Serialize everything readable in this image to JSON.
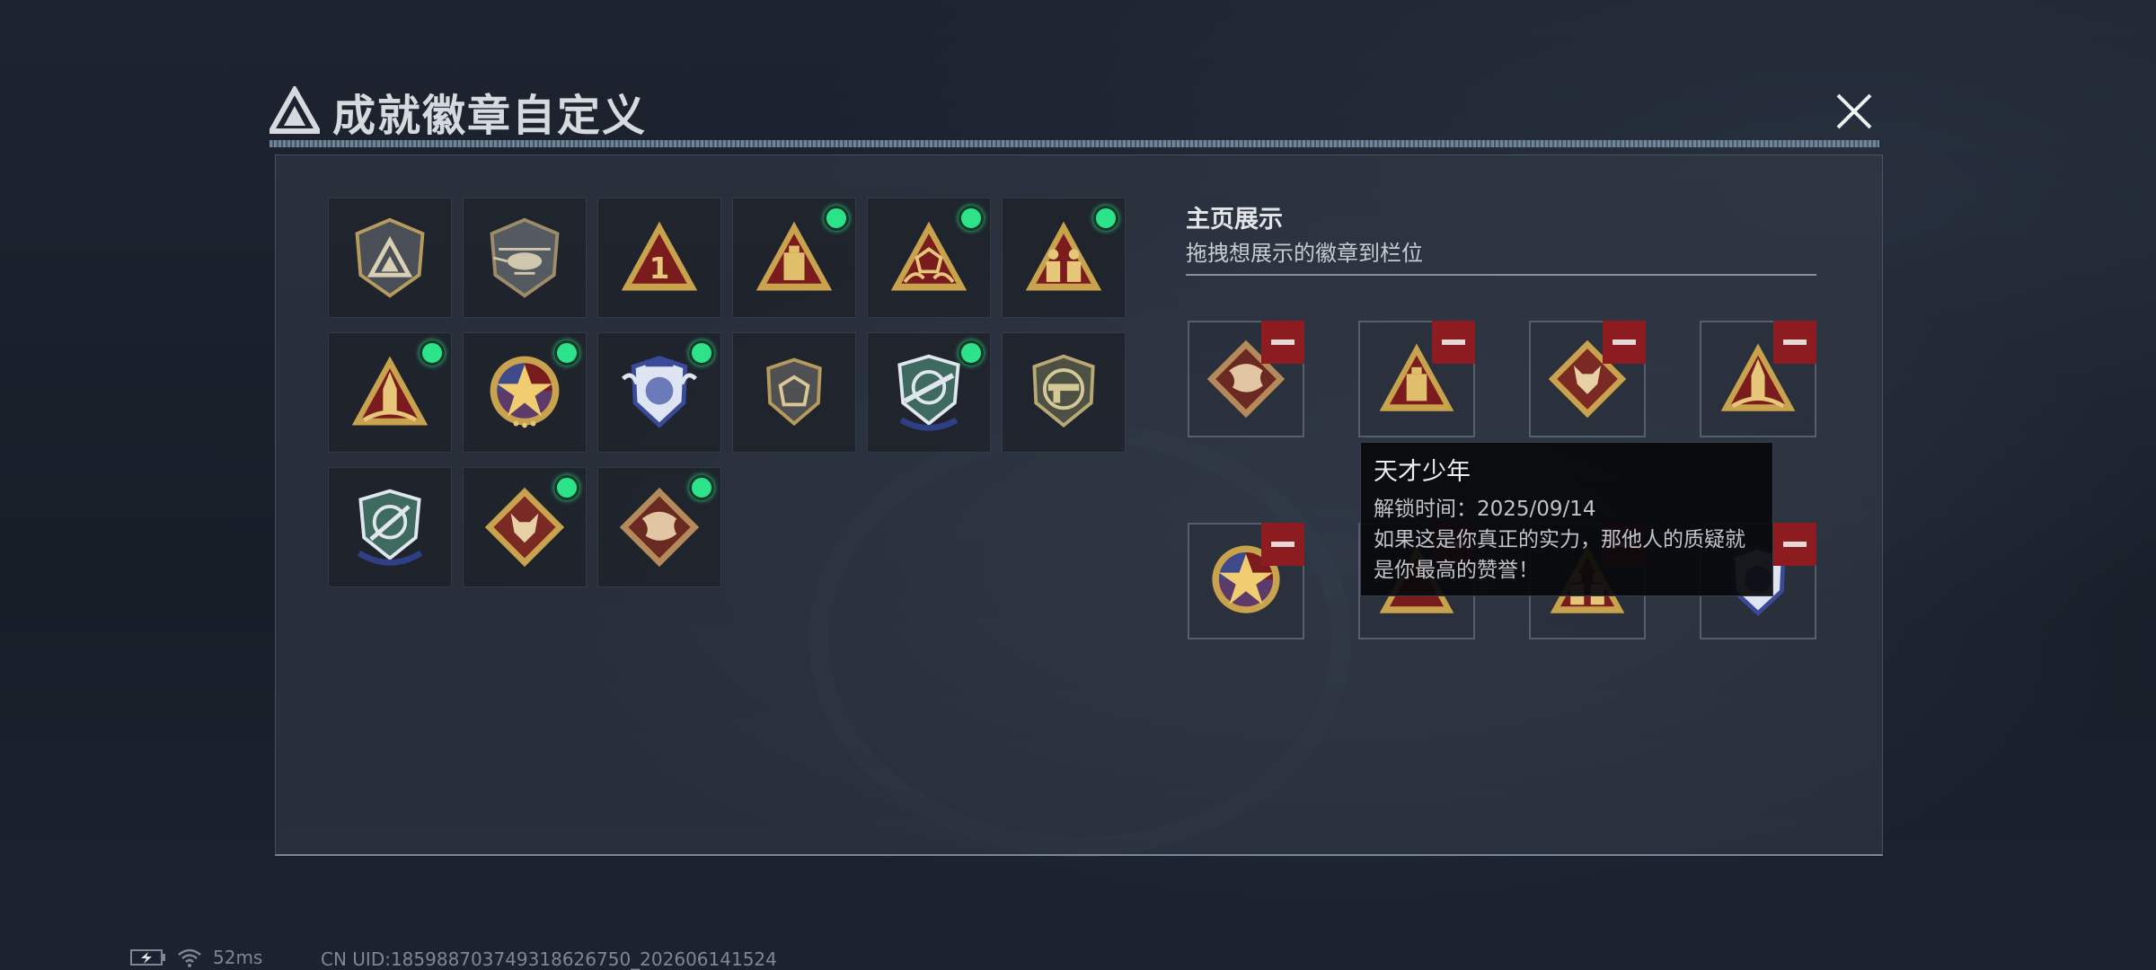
{
  "window": {
    "title": "成就徽章自定义"
  },
  "showcase": {
    "title": "主页展示",
    "subtitle": "拖拽想展示的徽章到栏位"
  },
  "badges": [
    {
      "icon": "triangle-logo-shield-badge-icon",
      "new": false
    },
    {
      "icon": "helicopter-shield-badge-icon",
      "new": false
    },
    {
      "icon": "number-one-triangle-badge-icon",
      "new": false
    },
    {
      "icon": "bottle-triangle-badge-icon",
      "new": true
    },
    {
      "icon": "dice-hands-triangle-badge-icon",
      "new": true
    },
    {
      "icon": "soldiers-triangle-badge-icon",
      "new": true
    },
    {
      "icon": "rocket-triangle-badge-icon",
      "new": true
    },
    {
      "icon": "star-medal-badge-icon",
      "new": true
    },
    {
      "icon": "wings-blue-shield-badge-icon",
      "new": true
    },
    {
      "icon": "dice-shield-badge-icon",
      "new": false
    },
    {
      "icon": "rifle-crosshair-shield-badge-icon",
      "new": true
    },
    {
      "icon": "gun-round-shield-badge-icon",
      "new": false
    },
    {
      "icon": "knife-crosshair-shield-badge-icon",
      "new": false
    },
    {
      "icon": "wolf-diamond-badge-icon",
      "new": true
    },
    {
      "icon": "dragon-diamond-badge-icon",
      "new": true
    }
  ],
  "slots": [
    {
      "icon": "dragon-diamond-badge-icon"
    },
    {
      "icon": "bottle-triangle-badge-icon"
    },
    {
      "icon": "wolf-diamond-badge-icon"
    },
    {
      "icon": "rocket-triangle-badge-icon"
    },
    {
      "icon": "star-medal-badge-icon"
    },
    {
      "icon": "triangle-badge-icon"
    },
    {
      "icon": "soldiers-triangle-badge-icon"
    },
    {
      "icon": "wings-blue-shield-badge-icon"
    }
  ],
  "tooltip": {
    "name": "天才少年",
    "unlock_time": "解锁时间：2025/09/14",
    "desc_line1": "如果这是你真正的实力，那他人的质疑就",
    "desc_line2": "是你最高的赞誉！"
  },
  "status": {
    "ping": "52ms",
    "uid": "CN UID:18598870374931862675​0_202606141524"
  },
  "colors": {
    "accent_new": "#2de38a",
    "remove": "#8c1c20",
    "gold": "#c9a24e",
    "maroon": "#7a1c1e"
  }
}
